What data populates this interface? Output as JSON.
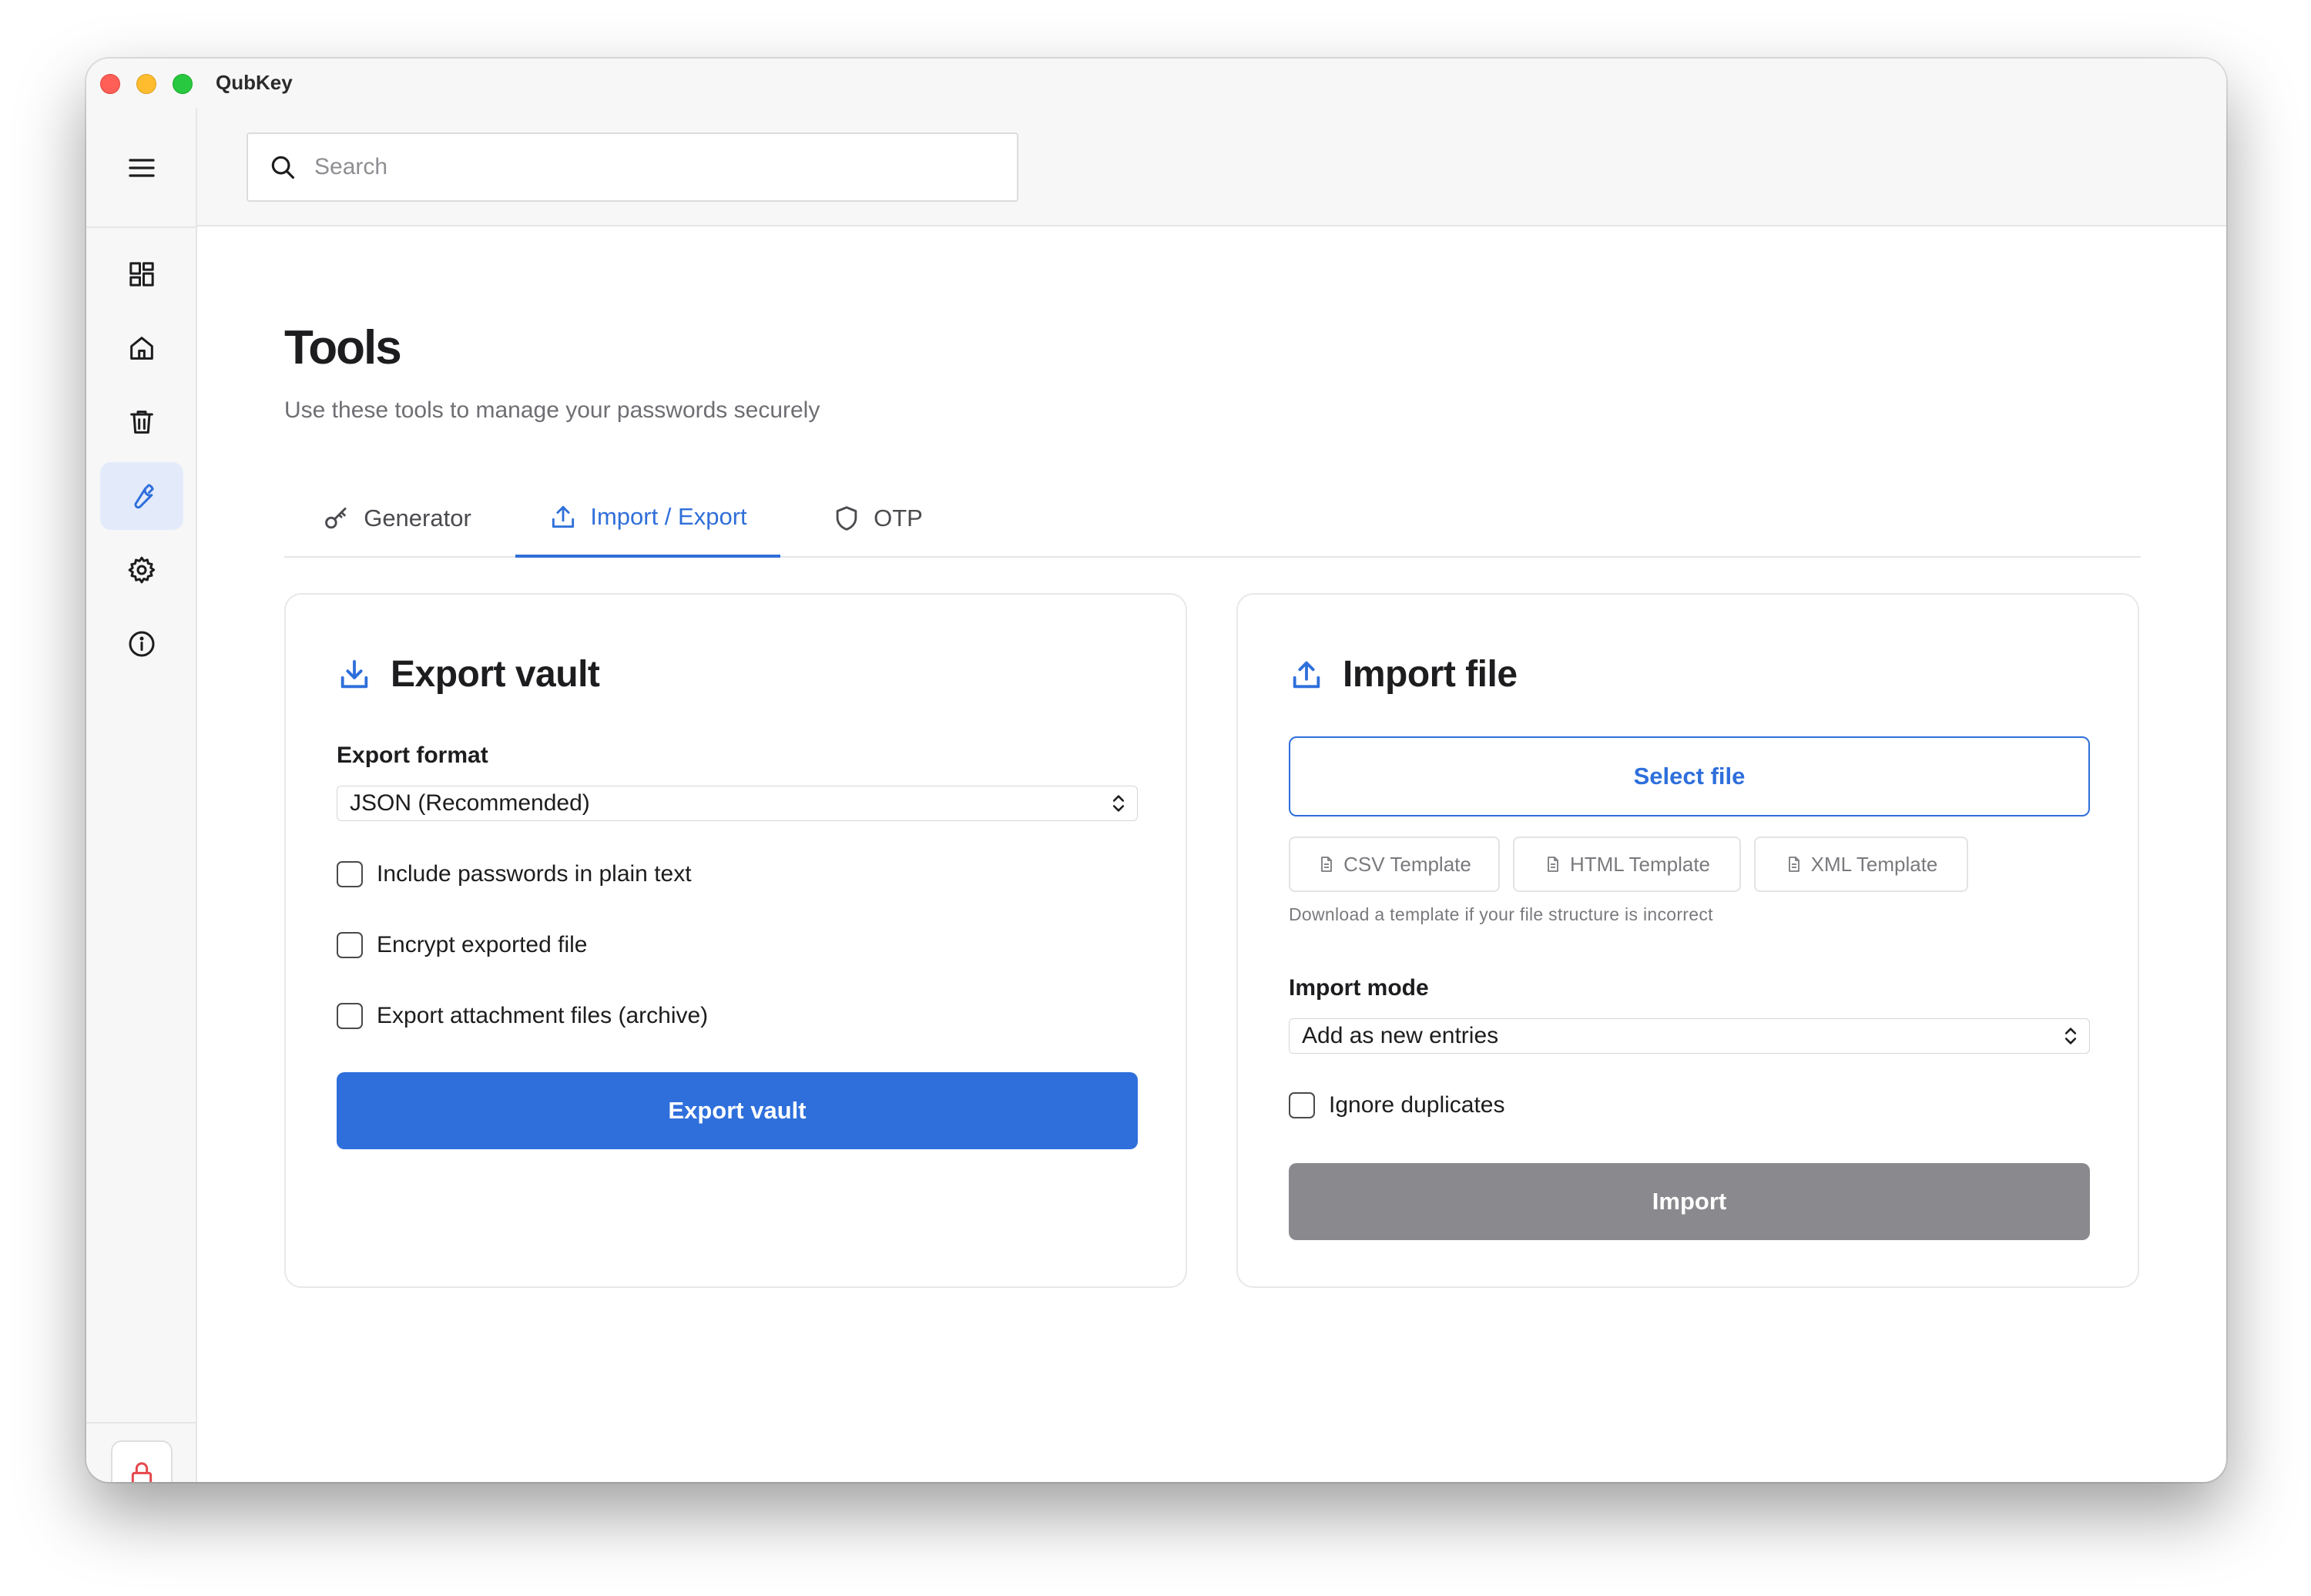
{
  "window": {
    "title": "QubKey"
  },
  "search": {
    "placeholder": "Search"
  },
  "sidebar": {
    "items": [
      {
        "name": "dashboard",
        "icon": "grid-icon"
      },
      {
        "name": "home",
        "icon": "home-icon"
      },
      {
        "name": "trash",
        "icon": "trash-icon"
      },
      {
        "name": "tools",
        "icon": "wrench-icon",
        "active": true
      },
      {
        "name": "settings",
        "icon": "gear-icon"
      },
      {
        "name": "about",
        "icon": "info-icon"
      }
    ],
    "lock_icon": "lock-icon"
  },
  "page": {
    "title": "Tools",
    "subtitle": "Use these tools to manage your passwords securely"
  },
  "tabs": [
    {
      "label": "Generator",
      "icon": "key-icon",
      "active": false
    },
    {
      "label": "Import / Export",
      "icon": "upload-icon",
      "active": true
    },
    {
      "label": "OTP",
      "icon": "shield-icon",
      "active": false
    }
  ],
  "export": {
    "title": "Export vault",
    "format_label": "Export format",
    "format_value": "JSON (Recommended)",
    "options": [
      {
        "label": "Include passwords in plain text",
        "checked": false
      },
      {
        "label": "Encrypt exported file",
        "checked": false
      },
      {
        "label": "Export attachment files (archive)",
        "checked": false
      }
    ],
    "button": "Export vault"
  },
  "import": {
    "title": "Import file",
    "select_button": "Select file",
    "templates": [
      "CSV Template",
      "HTML Template",
      "XML Template"
    ],
    "template_hint": "Download a template if your file structure is incorrect",
    "mode_label": "Import mode",
    "mode_value": "Add as new entries",
    "ignore_duplicates": {
      "label": "Ignore duplicates",
      "checked": false
    },
    "button": "Import"
  },
  "colors": {
    "accent": "#2e6fdb",
    "disabled": "#8a8a8e",
    "lock": "#e5484d",
    "active_nav_bg": "#e3ebfb"
  }
}
